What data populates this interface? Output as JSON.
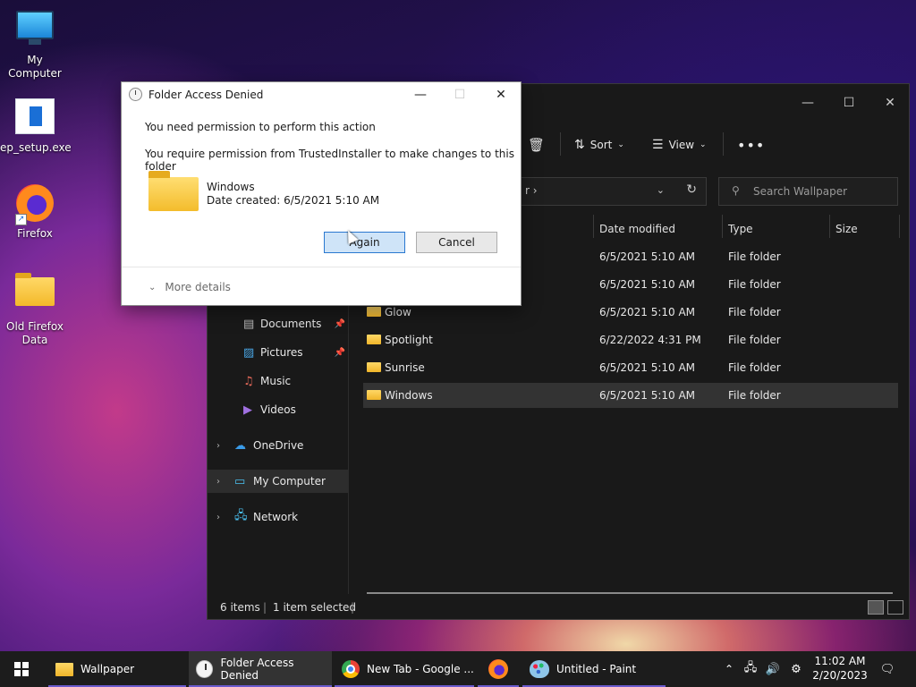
{
  "desktop": {
    "icons": [
      {
        "label": "My Computer"
      },
      {
        "label": "ep_setup.exe"
      },
      {
        "label": "Firefox"
      },
      {
        "label": "Old Firefox Data"
      }
    ]
  },
  "explorer": {
    "toolbar": {
      "sort_label": "Sort",
      "view_label": "View"
    },
    "address": {
      "crumb": "r ›"
    },
    "search": {
      "placeholder": "Search Wallpaper"
    },
    "nav": {
      "items": [
        {
          "label": "Documents"
        },
        {
          "label": "Pictures"
        },
        {
          "label": "Music"
        },
        {
          "label": "Videos"
        },
        {
          "label": "OneDrive"
        },
        {
          "label": "My Computer"
        },
        {
          "label": "Network"
        }
      ]
    },
    "columns": {
      "date": "Date modified",
      "type": "Type",
      "size": "Size"
    },
    "files": [
      {
        "name": "",
        "date": "6/5/2021 5:10 AM",
        "type": "File folder"
      },
      {
        "name": "",
        "date": "6/5/2021 5:10 AM",
        "type": "File folder"
      },
      {
        "name": "Glow",
        "date": "6/5/2021 5:10 AM",
        "type": "File folder"
      },
      {
        "name": "Spotlight",
        "date": "6/22/2022 4:31 PM",
        "type": "File folder"
      },
      {
        "name": "Sunrise",
        "date": "6/5/2021 5:10 AM",
        "type": "File folder"
      },
      {
        "name": "Windows",
        "date": "6/5/2021 5:10 AM",
        "type": "File folder"
      }
    ],
    "status": {
      "items": "6 items",
      "selected": "1 item selected"
    }
  },
  "dialog": {
    "title": "Folder Access Denied",
    "line1": "You need permission to perform this action",
    "line2": "You require permission from TrustedInstaller to make changes to this folder",
    "folder_name": "Windows",
    "date_created": "Date created: 6/5/2021 5:10 AM",
    "try_again": "Again",
    "cancel": "Cancel",
    "more_details": "More details"
  },
  "taskbar": {
    "apps": [
      {
        "label": "Wallpaper"
      },
      {
        "label": "Folder Access Denied"
      },
      {
        "label": "New Tab - Google ..."
      },
      {
        "label": ""
      },
      {
        "label": "Untitled - Paint"
      }
    ],
    "clock": {
      "time": "11:02 AM",
      "date": "2/20/2023"
    }
  },
  "colors": {
    "accent": "#2a78d0",
    "taskbar": "#1c1c1c",
    "explorer_bg": "#191919"
  }
}
